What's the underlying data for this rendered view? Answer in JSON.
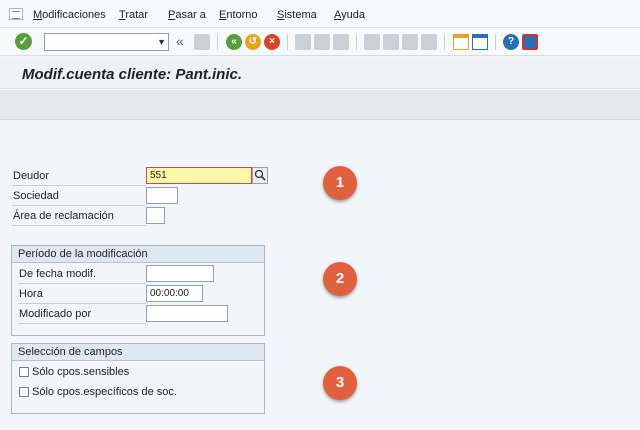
{
  "menubar": {
    "items": [
      {
        "label": "Modificaciones",
        "mnemonic": "M",
        "rest": "odificaciones"
      },
      {
        "label": "Tratar",
        "mnemonic": "T",
        "rest": "ratar"
      },
      {
        "label": "Pasar a",
        "mnemonic": "P",
        "rest": "asar a"
      },
      {
        "label": "Entorno",
        "mnemonic": "E",
        "rest": "ntorno"
      },
      {
        "label": "Sistema",
        "mnemonic": "S",
        "rest": "istema"
      },
      {
        "label": "Ayuda",
        "mnemonic": "A",
        "rest": "yuda"
      }
    ]
  },
  "toolbar": {
    "command_value": "",
    "icons": [
      "enter-check-icon",
      "command-dropdown-icon",
      "double-chevron-left-icon",
      "save-icon",
      "back-icon",
      "exit-icon",
      "cancel-icon",
      "print-icon",
      "find-icon",
      "find-next-icon",
      "first-page-icon",
      "previous-page-icon",
      "next-page-icon",
      "last-page-icon",
      "create-session-icon",
      "shortcut-icon",
      "help-icon",
      "customize-layout-icon"
    ],
    "accent_green": "#55a03c",
    "accent_orange": "#e9a21f",
    "accent_red": "#d9452b",
    "accent_blue": "#2a6fb5"
  },
  "title": "Modif.cuenta cliente: Pant.inic.",
  "form": {
    "deudor": {
      "label": "Deudor",
      "value": "551"
    },
    "sociedad": {
      "label": "Sociedad",
      "value": ""
    },
    "area": {
      "label": "Área de reclamación",
      "value": ""
    }
  },
  "period_group": {
    "title": "Período de la modificación",
    "fecha": {
      "label": "De fecha modif.",
      "value": ""
    },
    "hora": {
      "label": "Hora",
      "value": "00:00:00"
    },
    "modificado": {
      "label": "Modificado por",
      "value": ""
    }
  },
  "fields_group": {
    "title": "Selección de campos",
    "option1": {
      "label": "Sólo cpos.sensibles",
      "checked": false
    },
    "option2": {
      "label": "Sólo cpos.específicos de soc.",
      "checked": false
    }
  },
  "steps": [
    "1",
    "2",
    "3"
  ],
  "colors": {
    "step_badge": "#e1603d",
    "focus_field": "#fff7a8",
    "background": "#f2f6fa"
  }
}
